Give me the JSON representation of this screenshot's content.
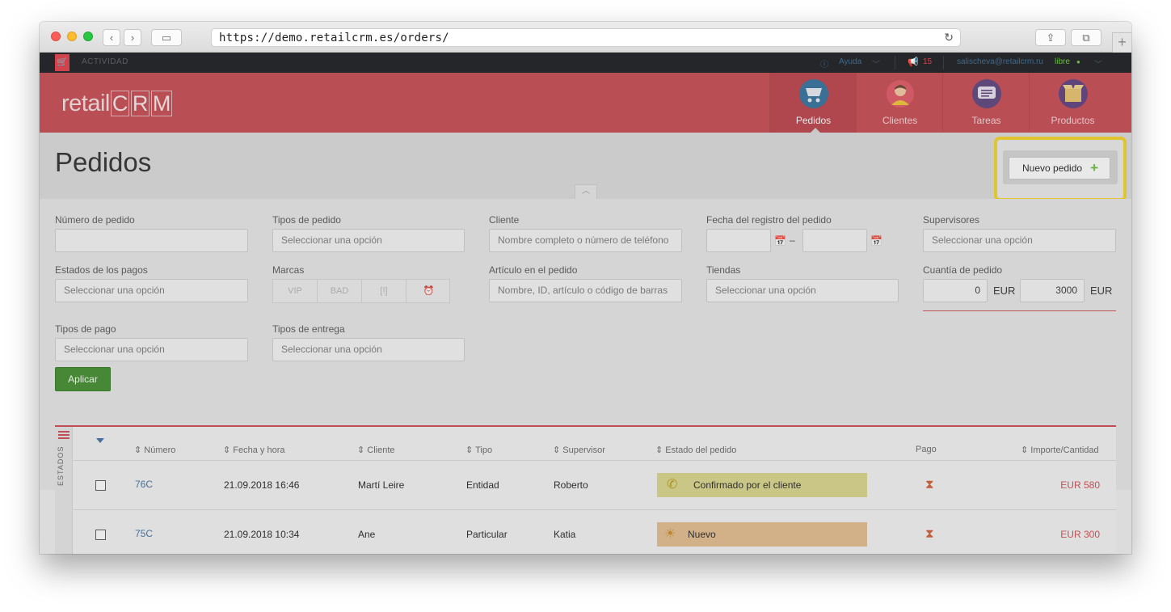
{
  "browser": {
    "url": "https://demo.retailcrm.es/orders/",
    "reload_icon": "reload-icon"
  },
  "topbar": {
    "activity": "ACTIVIDAD",
    "help": "Ayuda",
    "notifications": "15",
    "user_email": "salischeva@retailcrm.ru",
    "status": "libre"
  },
  "header": {
    "logo_prefix": "retail",
    "logo_letters": [
      "C",
      "R",
      "M"
    ],
    "nav": [
      {
        "label": "Pedidos",
        "icon": "cart-icon",
        "color": "#2f6e9c"
      },
      {
        "label": "Clientes",
        "icon": "person-icon",
        "color": "#c8474f"
      },
      {
        "label": "Tareas",
        "icon": "chat-list-icon",
        "color": "#5a3f7a"
      },
      {
        "label": "Productos",
        "icon": "box-icon",
        "color": "#5b3c7e"
      }
    ]
  },
  "page": {
    "title": "Pedidos",
    "new_order_button": "Nuevo pedido",
    "plus": "+"
  },
  "filters": {
    "order_number": {
      "label": "Número de pedido",
      "value": ""
    },
    "order_types": {
      "label": "Tipos de pedido",
      "placeholder": "Seleccionar una opción"
    },
    "client": {
      "label": "Cliente",
      "placeholder": "Nombre completo o número de teléfono"
    },
    "registration_date": {
      "label": "Fecha del registro del pedido",
      "separator": "–"
    },
    "supervisors": {
      "label": "Supervisores",
      "placeholder": "Seleccionar una opción"
    },
    "payment_statuses": {
      "label": "Estados de los pagos",
      "placeholder": "Seleccionar una opción"
    },
    "marks": {
      "label": "Marcas",
      "items": [
        "VIP",
        "BAD",
        "[!]",
        "⏰"
      ]
    },
    "order_article": {
      "label": "Artículo en el pedido",
      "placeholder": "Nombre, ID, artículo o código de barras"
    },
    "stores": {
      "label": "Tiendas",
      "placeholder": "Seleccionar una opción"
    },
    "order_amount": {
      "label": "Cuantía de pedido",
      "min": "0",
      "max": "3000",
      "currency": "EUR"
    },
    "payment_types": {
      "label": "Tipos de pago",
      "placeholder": "Seleccionar una opción"
    },
    "delivery_types": {
      "label": "Tipos de entrega",
      "placeholder": "Seleccionar una opción"
    },
    "apply_button": "Aplicar"
  },
  "table": {
    "side_label": "ESTADOS",
    "headers": [
      "Número",
      "Fecha y hora",
      "Cliente",
      "Tipo",
      "Supervisor",
      "Estado del pedido",
      "Pago",
      "Importe/Cantidad"
    ],
    "rows": [
      {
        "number": "76C",
        "datetime": "21.09.2018 16:46",
        "client": "Martí Leire",
        "type": "Entidad",
        "supervisor": "Roberto",
        "status": "Confirmado por el cliente",
        "status_color": "#d9d68a",
        "status_icon": "phone-icon",
        "amount": "EUR 580"
      },
      {
        "number": "75C",
        "datetime": "21.09.2018 10:34",
        "client": "Ane",
        "type": "Particular",
        "supervisor": "Katia",
        "status": "Nuevo",
        "status_color": "#e5bd8c",
        "status_icon": "lightbulb-icon",
        "amount": "EUR 300"
      }
    ]
  }
}
